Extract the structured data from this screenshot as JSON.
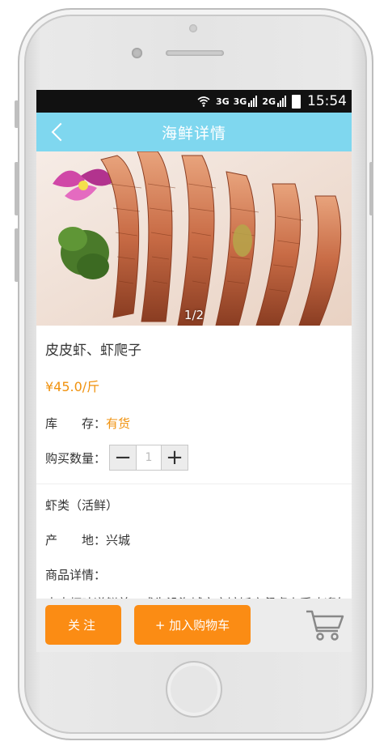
{
  "status_bar": {
    "net1": "3G",
    "net2": "3G",
    "net3": "2G",
    "time": "15:54"
  },
  "nav": {
    "title": "海鲜详情"
  },
  "gallery": {
    "pager": "1/2"
  },
  "product": {
    "name": "皮皮虾、虾爬子",
    "price": "¥45.0/斤",
    "stock_label": "库　　存：",
    "stock_value": "有货",
    "qty_label": "购买数量：",
    "qty_value": "1",
    "qty_minus": "−",
    "qty_plus": "+",
    "category": "虾类（活鲜）",
    "origin_label": "产　　地：",
    "origin_value": "兴城",
    "detail_label": "商品详情：",
    "detail_text": "皮皮虾味道鲜美，成为没海城市宾馆饭店餐桌上受欢迎的"
  },
  "actions": {
    "follow": "关注",
    "add_to_cart": "+ 加入购物车"
  },
  "colors": {
    "nav": "#7fd7ef",
    "accent": "#f0920e",
    "button": "#fb8c14"
  }
}
